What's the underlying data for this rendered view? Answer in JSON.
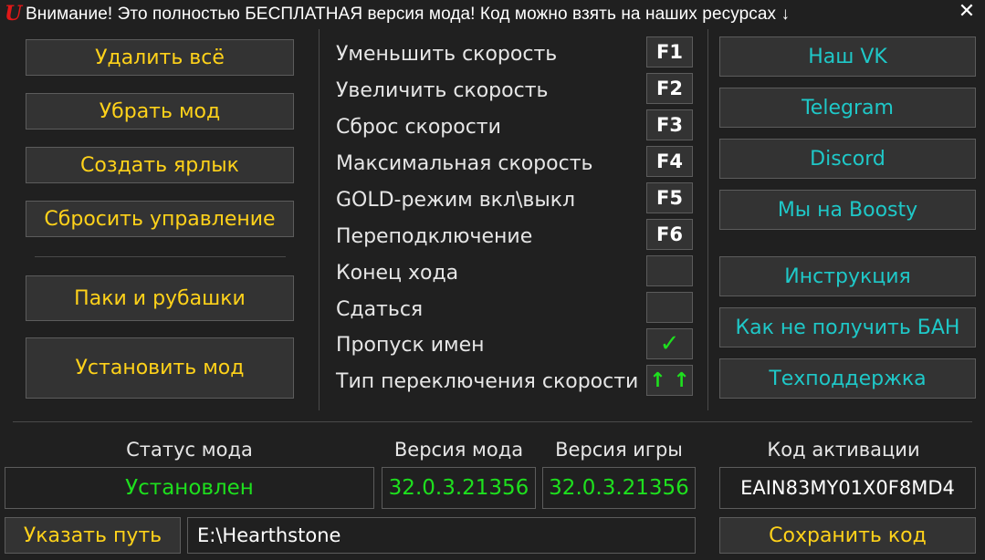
{
  "titlebar": {
    "logo": "U",
    "title": "Внимание! Это полностью БЕСПЛАТНАЯ версия мода! Код можно взять на наших ресурсах ↓",
    "close": "✕"
  },
  "left_buttons": {
    "delete_all": "Удалить всё",
    "remove_mod": "Убрать мод",
    "create_shortcut": "Создать ярлык",
    "reset_controls": "Сбросить управление",
    "packs_shirts": "Паки и рубашки",
    "install_mod": "Установить мод"
  },
  "hotkeys": [
    {
      "label": "Уменьшить скорость",
      "key": "F1"
    },
    {
      "label": "Увеличить скорость",
      "key": "F2"
    },
    {
      "label": "Сброс скорости",
      "key": "F3"
    },
    {
      "label": "Максимальная скорость",
      "key": "F4"
    },
    {
      "label": "GOLD-режим вкл\\выкл",
      "key": "F5"
    },
    {
      "label": "Переподключение",
      "key": "F6"
    },
    {
      "label": "Конец хода",
      "key": ""
    },
    {
      "label": "Сдаться",
      "key": ""
    },
    {
      "label": "Пропуск имен",
      "key": "✓"
    },
    {
      "label": "Тип переключения скорости",
      "key": "↑ ↑"
    }
  ],
  "right_buttons": {
    "vk": "Наш VK",
    "telegram": "Telegram",
    "discord": "Discord",
    "boosty": "Мы на Boosty",
    "instruction": "Инструкция",
    "no_ban": "Как не получить БАН",
    "support": "Техподдержка"
  },
  "bottom": {
    "status_label": "Статус мода",
    "status_value": "Установлен",
    "mod_version_label": "Версия мода",
    "mod_version_value": "32.0.3.21356",
    "game_version_label": "Версия игры",
    "game_version_value": "32.0.3.21356",
    "activation_label": "Код активации",
    "activation_value": "EAIN83MY01X0F8MD4",
    "set_path": "Указать путь",
    "path_value": "E:\\Hearthstone",
    "save_code": "Сохранить код"
  },
  "colors": {
    "background": "#202020",
    "button_bg": "#333333",
    "border": "#5c5c5c",
    "yellow": "#ffd21a",
    "cyan": "#1fc8c8",
    "green": "#1ee01e",
    "logo_red": "#e01818"
  }
}
